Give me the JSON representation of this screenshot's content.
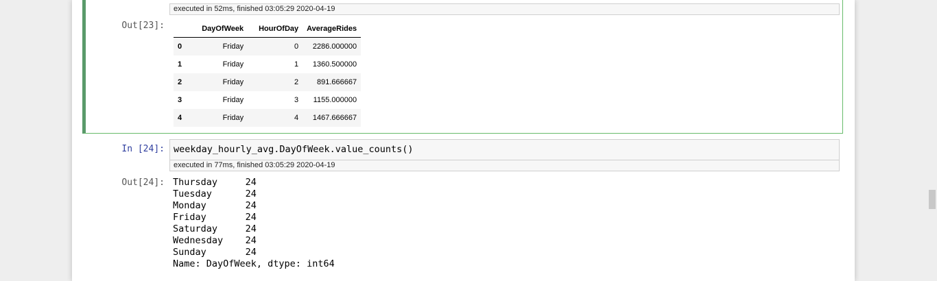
{
  "cell23": {
    "exec_info": "executed in 52ms, finished 03:05:29 2020-04-19",
    "out_prompt": "Out[23]:",
    "table": {
      "columns": [
        "",
        "DayOfWeek",
        "HourOfDay",
        "AverageRides"
      ],
      "rows": [
        [
          "0",
          "Friday",
          "0",
          "2286.000000"
        ],
        [
          "1",
          "Friday",
          "1",
          "1360.500000"
        ],
        [
          "2",
          "Friday",
          "2",
          "891.666667"
        ],
        [
          "3",
          "Friday",
          "3",
          "1155.000000"
        ],
        [
          "4",
          "Friday",
          "4",
          "1467.666667"
        ]
      ]
    }
  },
  "cell24": {
    "in_prompt": "In [24]:",
    "code": "weekday_hourly_avg.DayOfWeek.value_counts()",
    "exec_info": "executed in 77ms, finished 03:05:29 2020-04-19",
    "out_prompt": "Out[24]:",
    "output": "Thursday     24\nTuesday      24\nMonday       24\nFriday       24\nSaturday     24\nWednesday    24\nSunday       24\nName: DayOfWeek, dtype: int64"
  }
}
